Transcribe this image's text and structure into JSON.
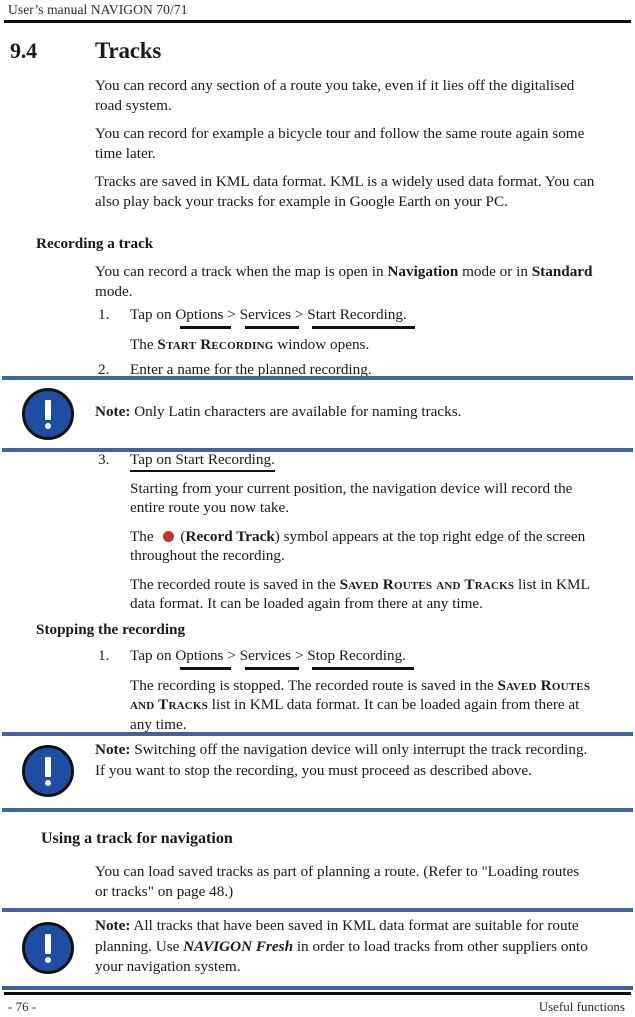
{
  "header": {
    "running_head": "User’s manual NAVIGON 70/71"
  },
  "chapter": {
    "number": "9.4",
    "title": "Tracks"
  },
  "intro": {
    "p1": "You can record any section of a route you take, even if it lies off the digitalised road system.",
    "p2": "You can record for example a bicycle tour and follow the same route again some time later.",
    "p3": "Tracks are saved in KML data format. KML is a widely used data format. You can also play back your tracks for example in Google Earth on your PC."
  },
  "recording_section": {
    "heading": "Recording a track",
    "intro_a": "You can record a track when the map is open in ",
    "intro_bold1": "Navigation",
    "intro_b": " mode or in ",
    "intro_bold2": "Standard",
    "intro_c": " mode.",
    "step1_num": "1.",
    "step1_lead": "Tap on ",
    "step1_menu1": "Options",
    "step1_sep1": " > ",
    "step1_menu2": "Services",
    "step1_sep2": " > ",
    "step1_menu3": "Start Recording.",
    "step1_result_a": "The ",
    "step1_result_sc": "Start Recording",
    "step1_result_b": " window opens.",
    "step2_num": "2.",
    "step2_text": "Enter a name for the planned recording."
  },
  "note1": {
    "label": "Note:",
    "text": " Only Latin characters are available for naming tracks.",
    "icon": "exclamation-circle-icon",
    "rule_color": "#41619f",
    "icon_color": "#1d4ea2"
  },
  "recording_section2": {
    "step3_num": "3.",
    "step3_link": "Tap on Start Recording.",
    "step3_p1": "Starting from your current position, the navigation device will record the entire route you now take.",
    "step3_p2_a": "The ",
    "step3_p2_symbol": "record-track-dot",
    "step3_p2_b": "(",
    "step3_p2_bold": "Record Track",
    "step3_p2_c": ") symbol appears at the top right edge of the screen throughout the recording.",
    "step3_p3_a": "The recorded route is saved in the ",
    "step3_p3_sc": "Saved Routes and Tracks",
    "step3_p3_b": " list in KML data format. It can be loaded again from there at any time.",
    "record_dot_color": "#c0342c"
  },
  "stopping_section": {
    "heading": "Stopping the recording",
    "step1_num": "1.",
    "step1_lead": "Tap on ",
    "step1_menu1": "Options",
    "step1_sep1": " > ",
    "step1_menu2": "Services",
    "step1_sep2": " > ",
    "step1_menu3": "Stop Recording.",
    "step1_result_a": "The recording is stopped. The recorded route is saved in the ",
    "step1_result_sc": "Saved Routes and Tracks",
    "step1_result_b": " list in KML data format. It can be loaded again from there at any time."
  },
  "note2": {
    "label": "Note:",
    "text": " Switching off the navigation device will only interrupt the track recording. If you want to stop the recording, you must proceed as described above.",
    "icon": "exclamation-circle-icon"
  },
  "using_section": {
    "heading": "Using a track for navigation",
    "para": "You can load saved tracks as part of planning a route. (Refer to \"Loading routes or tracks\" on page 48.)"
  },
  "note3": {
    "label": "Note:",
    "text_a": " All tracks that have been saved in KML data format are suitable for route planning. Use ",
    "product": "NAVIGON Fresh",
    "text_b": " in order to load tracks from other suppliers onto your navigation system.",
    "icon": "exclamation-circle-icon"
  },
  "footer": {
    "page_number": "- 76 -",
    "section_name": "Useful functions"
  }
}
